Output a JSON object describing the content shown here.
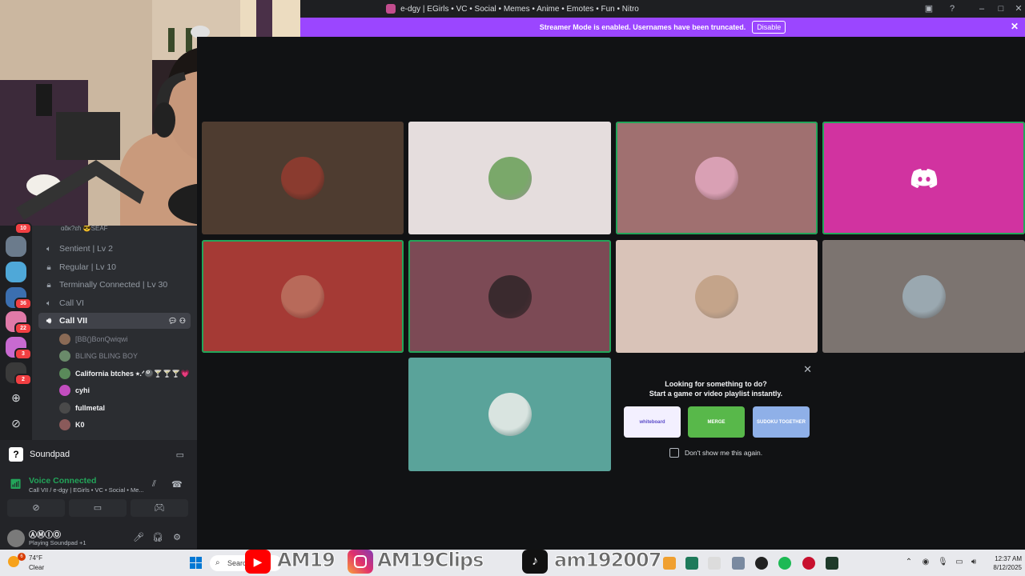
{
  "window": {
    "title": "e-dgy | EGirls • VC • Social • Memes • Anime • Emotes • Fun • Nitro"
  },
  "banner": {
    "text": "Streamer Mode is enabled. Usernames have been truncated.",
    "button": "Disable"
  },
  "servers": [
    {
      "color": "#6b7b8c",
      "badge": ""
    },
    {
      "color": "#4fa8d8",
      "badge": ""
    },
    {
      "color": "#3b6fb0",
      "badge": "36"
    },
    {
      "color": "#e07aa8",
      "badge": "22"
    },
    {
      "color": "#c86ad0",
      "badge": "3"
    },
    {
      "color": "#3a3a3a",
      "badge": "2"
    }
  ],
  "top_badge": "10",
  "channels": {
    "top_user": "ɑɑ̃ĸ?ɛɦ   😎SEAF",
    "items": [
      {
        "icon": "speaker",
        "label": "Sentient | Lv 2"
      },
      {
        "icon": "lock",
        "label": "Regular | Lv 10"
      },
      {
        "icon": "lock",
        "label": "Terminally Connected | Lv 30"
      },
      {
        "icon": "speaker",
        "label": "Call VI"
      },
      {
        "icon": "speaker",
        "label": "Call VII"
      }
    ],
    "voice_users": [
      {
        "name": "[BB()BonQwiqwi",
        "color": "#8a6a55",
        "style": "muted"
      },
      {
        "name": "BLING BLING BOY",
        "color": "#6a8a6a",
        "style": "muted"
      },
      {
        "name": "California btches ⭑.ᐟ🎱🍸🍸🍸💗",
        "color": "#5a8a5a",
        "style": "speak"
      },
      {
        "name": "cyhi",
        "color": "#c24dbf",
        "style": "speak"
      },
      {
        "name": "fullmetal",
        "color": "#4a4a4a",
        "style": "speak"
      },
      {
        "name": "K0",
        "color": "#8a5a5a",
        "style": "speak"
      }
    ]
  },
  "soundpad": {
    "label": "Soundpad"
  },
  "voice": {
    "status": "Voice Connected",
    "channel": "Call VII / e-dgy | EGirls • VC • Social • Me..."
  },
  "user": {
    "name": "ⒶⓂⒾⓄ",
    "status": "Playing Soundpad +1"
  },
  "tiles": [
    {
      "bg": "#4e3c30",
      "avatar": "#8a3b2f",
      "speaking": false
    },
    {
      "bg": "#e5dddd",
      "avatar": "#7aa86a",
      "speaking": false
    },
    {
      "bg": "#a07070",
      "avatar": "#d9a0b4",
      "speaking": true
    },
    {
      "bg": "#d133a0",
      "avatar": "discord",
      "speaking": true
    },
    {
      "bg": "#a53a35",
      "avatar": "#b86a5a",
      "speaking": true
    },
    {
      "bg": "#7c4a55",
      "avatar": "#3a2a2e",
      "speaking": true
    },
    {
      "bg": "#d9c3b8",
      "avatar": "#c4a48a",
      "speaking": false
    },
    {
      "bg": "#7c7470",
      "avatar": "#9aa8b0",
      "speaking": false
    },
    {
      "bg": "#5aa39a",
      "avatar": "#d9e4e0",
      "speaking": false
    }
  ],
  "popup": {
    "title": "Looking for something to do?",
    "subtitle": "Start a game or video playlist instantly.",
    "activities": [
      {
        "label": "whiteboard",
        "color": "#f3f0ff"
      },
      {
        "label": "MERGE",
        "color": "#58b84a"
      },
      {
        "label": "SUDOKU TOGETHER",
        "color": "#8fb0e8"
      }
    ],
    "dont_show": "Don't show me this again."
  },
  "taskbar": {
    "temp": "74°F",
    "condition": "Clear",
    "weather_badge": "6",
    "search": "Search",
    "time": "12:37 AM",
    "date": "8/12/2025"
  },
  "overlay": {
    "a": "AM19",
    "b": "AM19Clips",
    "c": "am192007"
  }
}
